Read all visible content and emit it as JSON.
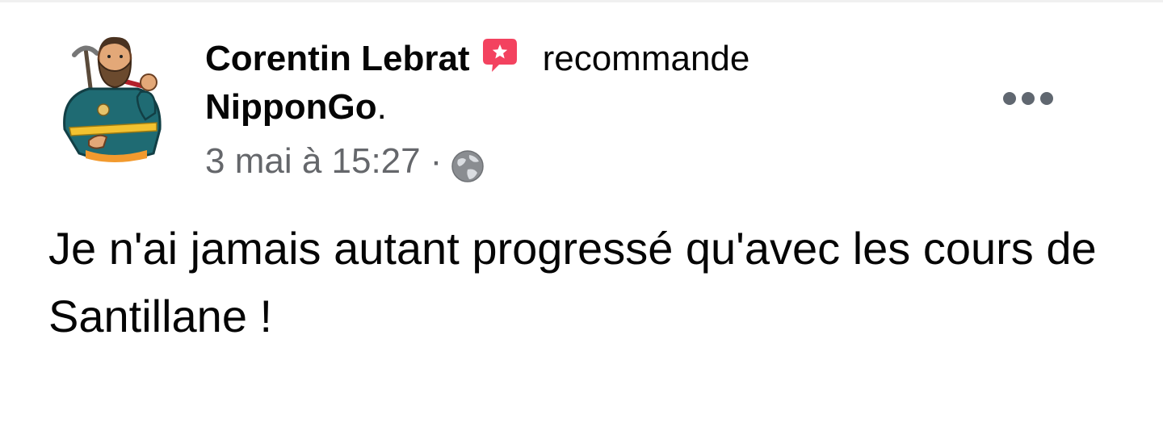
{
  "post": {
    "author": "Corentin Lebrat",
    "recommends_word": "recommande",
    "page_name": "NipponGo",
    "page_name_suffix": ".",
    "timestamp": "3 mai à 15:27",
    "separator": "·",
    "privacy_icon": "globe-icon",
    "recommend_icon": "speech-bubble-star-icon",
    "more_icon": "more-horizontal-icon",
    "body_text": "Je n'ai jamais autant progressé qu'avec les cours de Santillane !"
  },
  "colors": {
    "text_primary": "#050505",
    "text_secondary": "#65676b",
    "recommend_badge": "#f3425f"
  }
}
